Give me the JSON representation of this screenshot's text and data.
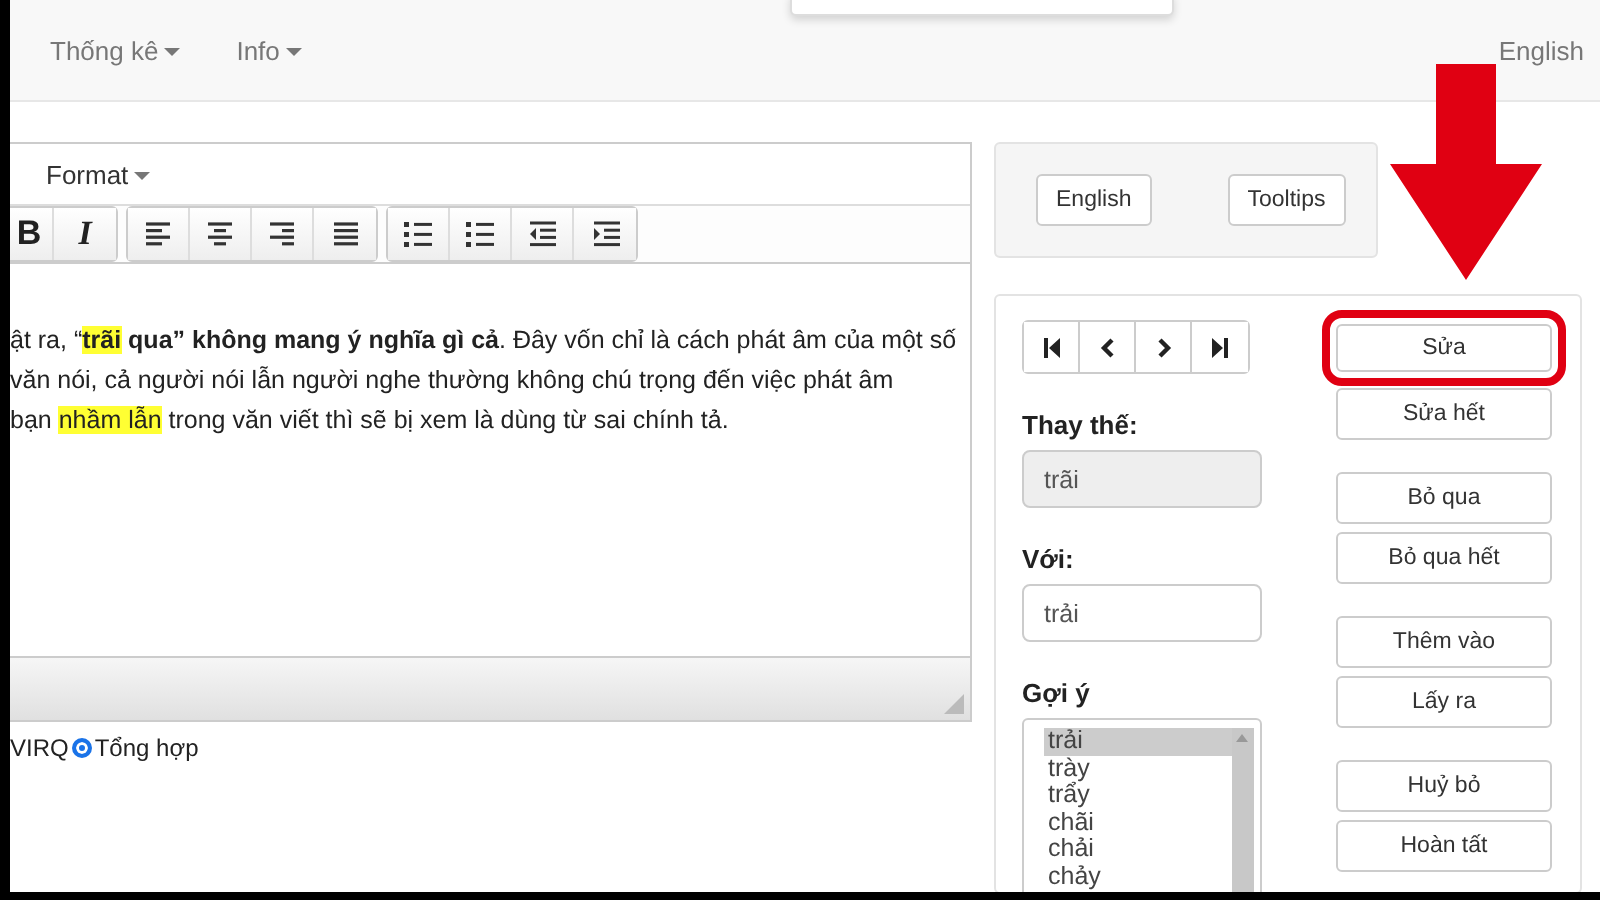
{
  "navbar": {
    "menus": [
      {
        "label": "Thống kê"
      },
      {
        "label": "Info"
      }
    ],
    "language": "English"
  },
  "editor": {
    "menu": "Format",
    "format_buttons": [
      {
        "label": "B",
        "kind": "bold"
      },
      {
        "label": "I",
        "kind": "italic"
      }
    ],
    "lines": [
      [
        {
          "text": "ật ra, “",
          "bold": false,
          "highlight": false
        },
        {
          "text": "trãi",
          "bold": true,
          "highlight": true
        },
        {
          "text": " qua” không mang ý nghĩa gì cả",
          "bold": true,
          "highlight": false
        },
        {
          "text": ". Đây vốn chỉ là cách phát âm của một số",
          "bold": false,
          "highlight": false
        }
      ],
      [
        {
          "text": " văn nói, cả người nói lẫn người nghe thường không chú trọng đến việc phát âm",
          "bold": false,
          "highlight": false
        }
      ],
      [
        {
          "text": "bạn ",
          "bold": false,
          "highlight": false
        },
        {
          "text": "nhầm lẫn",
          "bold": false,
          "highlight": true
        },
        {
          "text": " trong văn viết thì sẽ bị xem là dùng từ sai chính tả.",
          "bold": false,
          "highlight": false
        }
      ]
    ]
  },
  "mode": {
    "cut_label": "VIRQ",
    "radio": {
      "label": "Tổng hợp",
      "selected": true
    }
  },
  "options": {
    "buttons": [
      {
        "label": "English"
      },
      {
        "label": "Tooltips"
      }
    ]
  },
  "spell": {
    "replace_label": "Thay thế:",
    "replace_value": "trãi",
    "with_label": "Với:",
    "with_value": "trải",
    "suggest_label": "Gợi ý",
    "suggestions": [
      {
        "label": "trải",
        "selected": true
      },
      {
        "label": "trày",
        "selected": false
      },
      {
        "label": "trẩy",
        "selected": false
      },
      {
        "label": "chãi",
        "selected": false
      },
      {
        "label": "chải",
        "selected": false
      },
      {
        "label": "chảy",
        "selected": false
      }
    ],
    "actions": [
      {
        "label": "Sửa",
        "highlighted": true
      },
      {
        "label": "Sửa hết",
        "highlighted": false
      },
      {
        "label": "Bỏ qua",
        "highlighted": false
      },
      {
        "label": "Bỏ qua hết",
        "highlighted": false
      },
      {
        "label": "Thêm vào",
        "highlighted": false
      },
      {
        "label": "Lấy ra",
        "highlighted": false
      },
      {
        "label": "Huỷ bỏ",
        "highlighted": false
      },
      {
        "label": "Hoàn tất",
        "highlighted": false
      }
    ]
  }
}
